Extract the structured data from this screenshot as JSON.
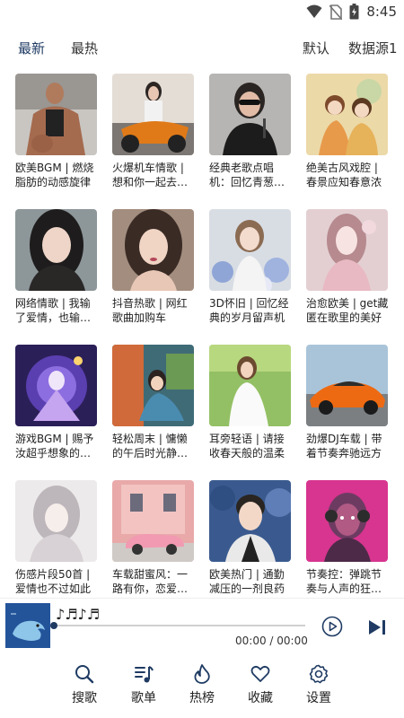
{
  "status": {
    "time": "8:45"
  },
  "tabs": {
    "latest": "最新",
    "hot": "最热",
    "default": "默认",
    "source": "数据源1"
  },
  "playlists": [
    {
      "title": "欧美BGM | 燃烧脂肪的动感旋律",
      "cover": "gym"
    },
    {
      "title": "火爆机车情歌 | 想和你一起去…",
      "cover": "motorbike"
    },
    {
      "title": "经典老歌点唱机：回忆青葱…",
      "cover": "singer"
    },
    {
      "title": "绝美古风戏腔 | 春景应知春意浓",
      "cover": "anime-girls"
    },
    {
      "title": "网络情歌 | 我输了爱情，也输…",
      "cover": "woman-portrait"
    },
    {
      "title": "抖音热歌 | 网红歌曲加购车",
      "cover": "woman-curls"
    },
    {
      "title": "3D怀旧 | 回忆经典的岁月留声机",
      "cover": "flowers-girl"
    },
    {
      "title": "治愈欧美 | get藏匿在歌里的美好",
      "cover": "pink-girl"
    },
    {
      "title": "游戏BGM | 赐予汝超乎想象的…",
      "cover": "game-purple"
    },
    {
      "title": "轻松周末 | 慵懒的午后时光静…",
      "cover": "reading-girl"
    },
    {
      "title": "耳旁轻语 | 请接收春天般的温柔",
      "cover": "grass-girl"
    },
    {
      "title": "劲爆DJ车载 | 带着节奏奔驰远方",
      "cover": "orange-car"
    },
    {
      "title": "伤感片段50首 | 爱情也不过如此",
      "cover": "sad-girl"
    },
    {
      "title": "车载甜蜜风：一路有你，恋爱…",
      "cover": "pink-car"
    },
    {
      "title": "欧美热门 | 通勤减压的一剂良药",
      "cover": "man-portrait"
    },
    {
      "title": "节奏控：弹跳节奏与人声的狂…",
      "cover": "robot-pink"
    }
  ],
  "player": {
    "song": "♪♬♪♬",
    "time": "00:00 / 00:00",
    "progress": 0
  },
  "nav": [
    {
      "label": "搜歌",
      "icon": "search-icon"
    },
    {
      "label": "歌单",
      "icon": "playlist-icon"
    },
    {
      "label": "热榜",
      "icon": "fire-icon"
    },
    {
      "label": "收藏",
      "icon": "heart-icon"
    },
    {
      "label": "设置",
      "icon": "gear-icon"
    }
  ],
  "colors": {
    "accent": "#1f3b63",
    "text": "#222222"
  }
}
